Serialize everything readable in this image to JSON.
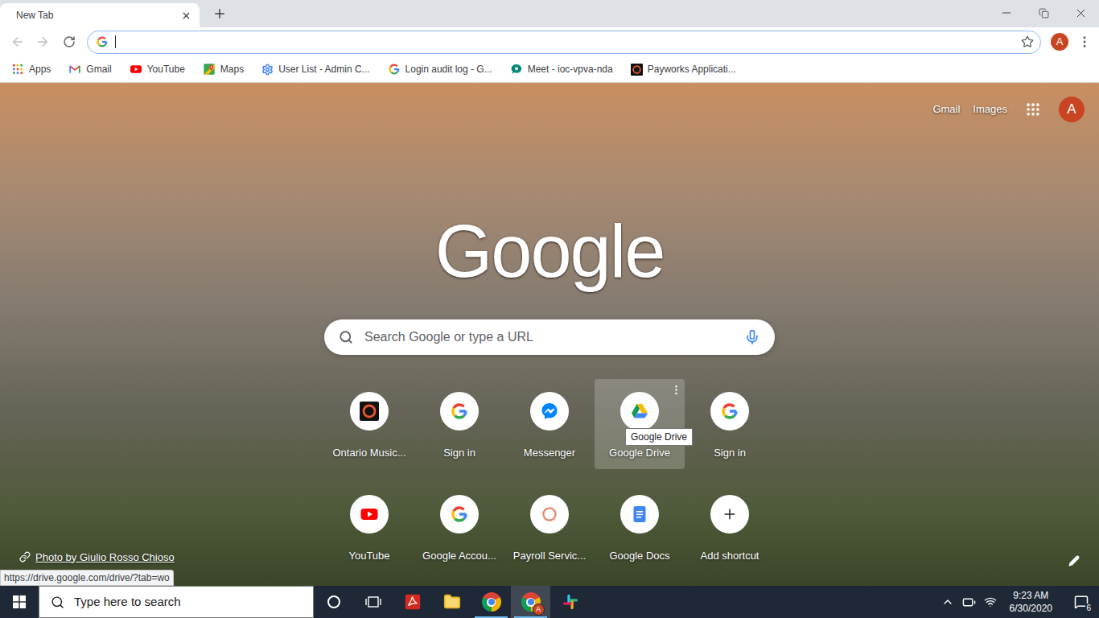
{
  "window": {
    "tab": {
      "title": "New Tab",
      "selected": true
    }
  },
  "toolbar": {
    "omnibox_focused": true,
    "avatar": "A"
  },
  "bookmarks": [
    {
      "label": "Apps",
      "kind": "apps"
    },
    {
      "label": "Gmail",
      "kind": "gmail"
    },
    {
      "label": "YouTube",
      "kind": "youtube"
    },
    {
      "label": "Maps",
      "kind": "maps"
    },
    {
      "label": "User List - Admin C...",
      "kind": "admin"
    },
    {
      "label": "Login audit log - G...",
      "kind": "google"
    },
    {
      "label": "Meet - ioc-vpva-nda",
      "kind": "meet"
    },
    {
      "label": "Payworks Applicati...",
      "kind": "payworks"
    }
  ],
  "ntp": {
    "links": [
      "Gmail",
      "Images"
    ],
    "avatar": "A",
    "logo": "Google",
    "search_placeholder": "Search Google or type a URL",
    "shortcuts": [
      {
        "label": "Ontario Music...",
        "kind": "ontario",
        "hovered": false
      },
      {
        "label": "Sign in",
        "kind": "google",
        "hovered": false
      },
      {
        "label": "Messenger",
        "kind": "messenger",
        "hovered": false
      },
      {
        "label": "Google Drive",
        "kind": "drive",
        "hovered": true
      },
      {
        "label": "Sign in",
        "kind": "google",
        "hovered": false
      },
      {
        "label": "YouTube",
        "kind": "youtube",
        "hovered": false
      },
      {
        "label": "Google Accou...",
        "kind": "google",
        "hovered": false
      },
      {
        "label": "Payroll Servic...",
        "kind": "payroll",
        "hovered": false
      },
      {
        "label": "Google Docs",
        "kind": "docs",
        "hovered": false
      },
      {
        "label": "Add shortcut",
        "kind": "add",
        "hovered": false
      }
    ],
    "tooltip": "Google Drive",
    "photo_credit": "Photo by Giulio Rosso Chioso"
  },
  "status_url": "https://drive.google.com/drive/?tab=wo",
  "taskbar": {
    "search_placeholder": "Type here to search",
    "items": [
      {
        "kind": "cortana",
        "active": false,
        "running": false,
        "badge": ""
      },
      {
        "kind": "taskview",
        "active": false,
        "running": false,
        "badge": ""
      },
      {
        "kind": "acrobat",
        "active": false,
        "running": false,
        "badge": ""
      },
      {
        "kind": "explorer",
        "active": false,
        "running": false,
        "badge": ""
      },
      {
        "kind": "chrome",
        "active": false,
        "running": true,
        "badge": ""
      },
      {
        "kind": "chrome-profile",
        "active": true,
        "running": true,
        "badge": "A"
      },
      {
        "kind": "slack",
        "active": false,
        "running": false,
        "badge": ""
      }
    ],
    "time": "9:23 AM",
    "date": "6/30/2020",
    "notifications": "6"
  }
}
